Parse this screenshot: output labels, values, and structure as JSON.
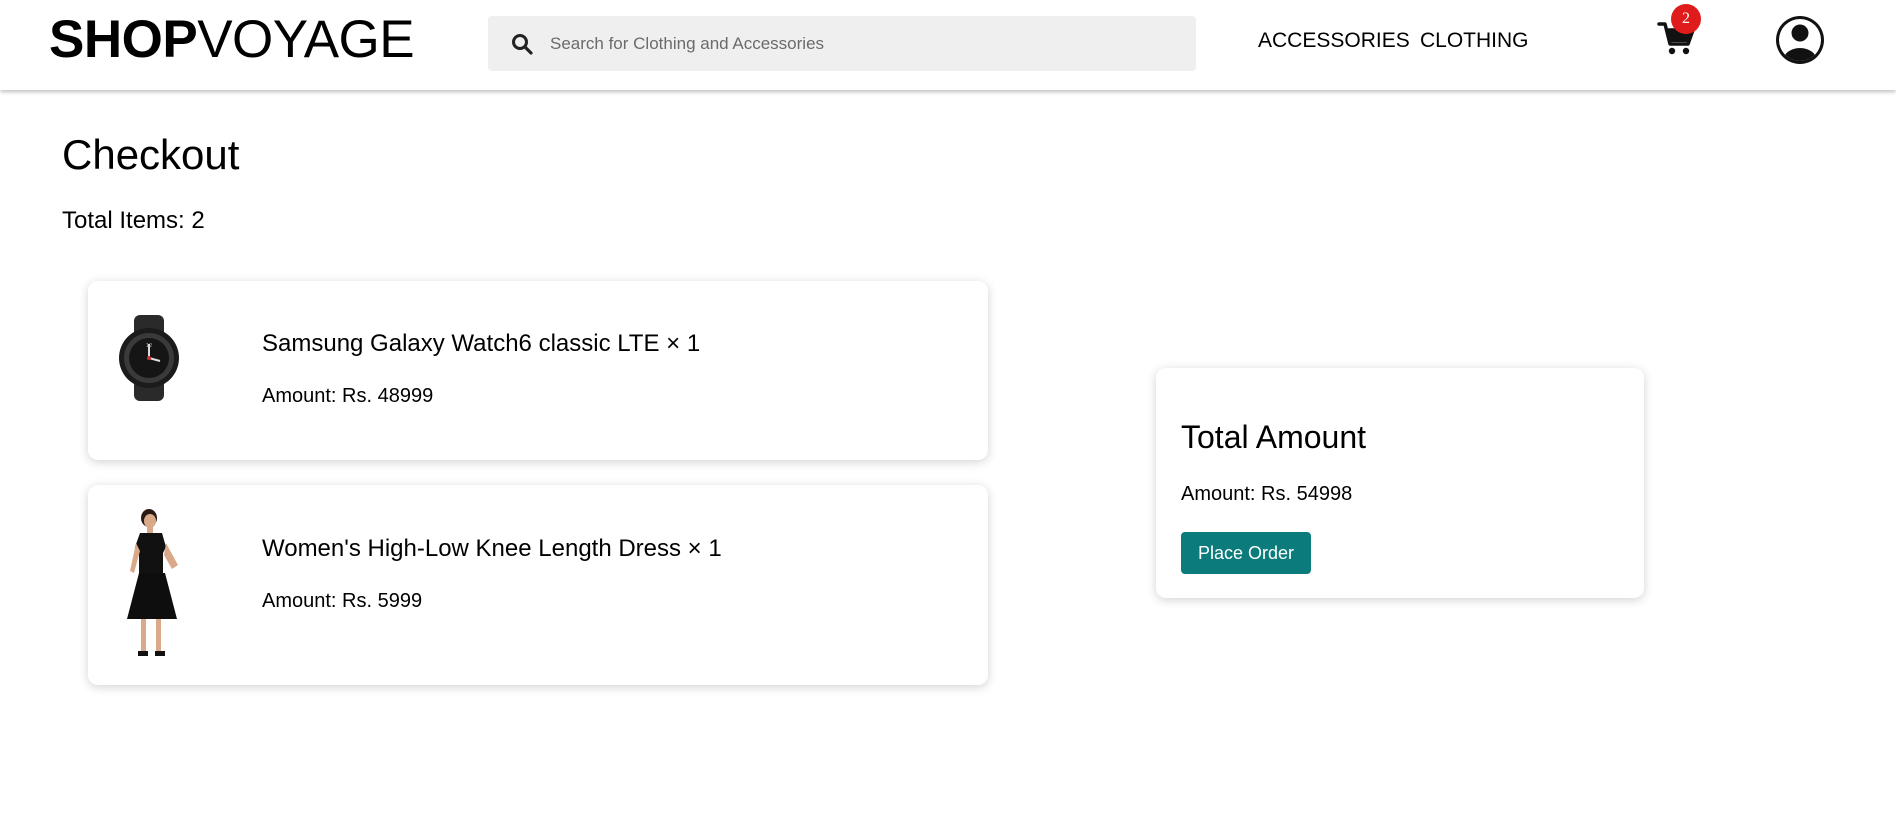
{
  "header": {
    "brand_bold": "SHOP",
    "brand_light": "VOYAGE",
    "search_placeholder": "Search for Clothing and Accessories",
    "search_value": "",
    "nav_accessories": "ACCESSORIES",
    "nav_clothing": "CLOTHING",
    "cart_count": "2"
  },
  "page": {
    "title": "Checkout",
    "total_items": "Total Items: 2"
  },
  "items": [
    {
      "name": "Samsung Galaxy Watch6 classic LTE × 1",
      "amount": "Amount: Rs. 48999"
    },
    {
      "name": "Women's High-Low Knee Length Dress × 1",
      "amount": "Amount: Rs. 5999"
    }
  ],
  "summary": {
    "title": "Total Amount",
    "amount": "Amount: Rs. 54998",
    "button_label": "Place Order"
  },
  "colors": {
    "accent": "#0c7b7b",
    "badge": "#e01b1b",
    "search_bg": "#efefef"
  },
  "icons": [
    "search-icon",
    "cart-icon",
    "user-account-icon"
  ]
}
